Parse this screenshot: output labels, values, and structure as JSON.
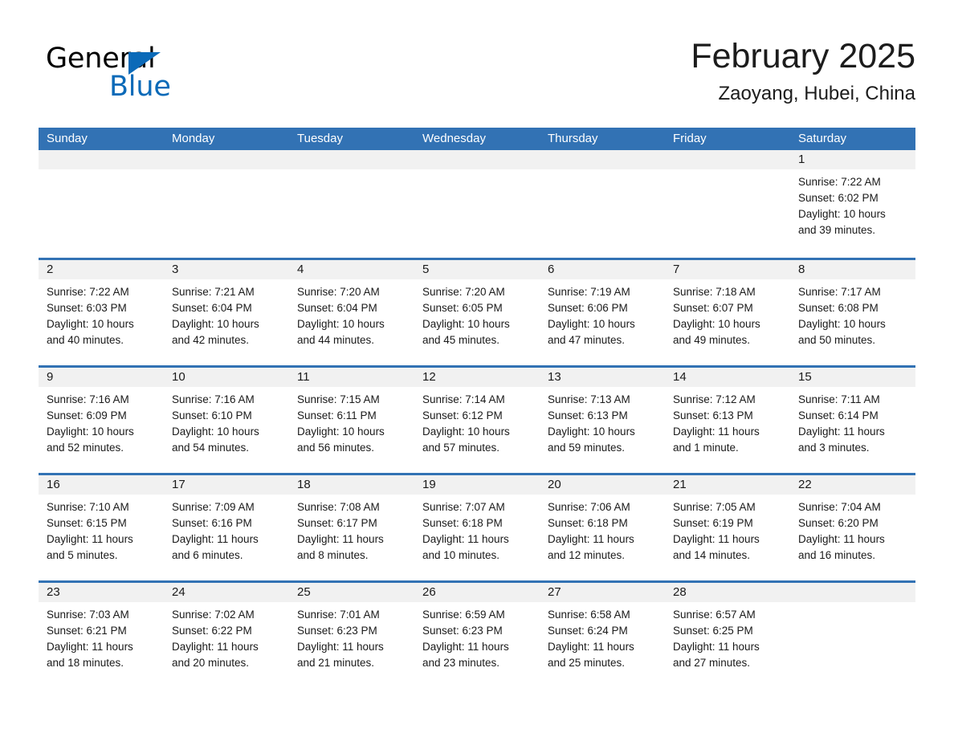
{
  "brand": {
    "name_part1": "General",
    "name_part2": "Blue",
    "accent_color": "#0b6ab8",
    "triangle_icon": "triangle-icon"
  },
  "header": {
    "title": "February 2025",
    "subtitle": "Zaoyang, Hubei, China"
  },
  "theme": {
    "header_blue": "#3272b4",
    "daynum_band": "#f1f1f1",
    "text": "#1a1a1a"
  },
  "calendar": {
    "weekday_headers": [
      "Sunday",
      "Monday",
      "Tuesday",
      "Wednesday",
      "Thursday",
      "Friday",
      "Saturday"
    ],
    "weeks": [
      [
        {
          "day": "",
          "lines": []
        },
        {
          "day": "",
          "lines": []
        },
        {
          "day": "",
          "lines": []
        },
        {
          "day": "",
          "lines": []
        },
        {
          "day": "",
          "lines": []
        },
        {
          "day": "",
          "lines": []
        },
        {
          "day": "1",
          "lines": [
            "Sunrise: 7:22 AM",
            "Sunset: 6:02 PM",
            "Daylight: 10 hours",
            "and 39 minutes."
          ]
        }
      ],
      [
        {
          "day": "2",
          "lines": [
            "Sunrise: 7:22 AM",
            "Sunset: 6:03 PM",
            "Daylight: 10 hours",
            "and 40 minutes."
          ]
        },
        {
          "day": "3",
          "lines": [
            "Sunrise: 7:21 AM",
            "Sunset: 6:04 PM",
            "Daylight: 10 hours",
            "and 42 minutes."
          ]
        },
        {
          "day": "4",
          "lines": [
            "Sunrise: 7:20 AM",
            "Sunset: 6:04 PM",
            "Daylight: 10 hours",
            "and 44 minutes."
          ]
        },
        {
          "day": "5",
          "lines": [
            "Sunrise: 7:20 AM",
            "Sunset: 6:05 PM",
            "Daylight: 10 hours",
            "and 45 minutes."
          ]
        },
        {
          "day": "6",
          "lines": [
            "Sunrise: 7:19 AM",
            "Sunset: 6:06 PM",
            "Daylight: 10 hours",
            "and 47 minutes."
          ]
        },
        {
          "day": "7",
          "lines": [
            "Sunrise: 7:18 AM",
            "Sunset: 6:07 PM",
            "Daylight: 10 hours",
            "and 49 minutes."
          ]
        },
        {
          "day": "8",
          "lines": [
            "Sunrise: 7:17 AM",
            "Sunset: 6:08 PM",
            "Daylight: 10 hours",
            "and 50 minutes."
          ]
        }
      ],
      [
        {
          "day": "9",
          "lines": [
            "Sunrise: 7:16 AM",
            "Sunset: 6:09 PM",
            "Daylight: 10 hours",
            "and 52 minutes."
          ]
        },
        {
          "day": "10",
          "lines": [
            "Sunrise: 7:16 AM",
            "Sunset: 6:10 PM",
            "Daylight: 10 hours",
            "and 54 minutes."
          ]
        },
        {
          "day": "11",
          "lines": [
            "Sunrise: 7:15 AM",
            "Sunset: 6:11 PM",
            "Daylight: 10 hours",
            "and 56 minutes."
          ]
        },
        {
          "day": "12",
          "lines": [
            "Sunrise: 7:14 AM",
            "Sunset: 6:12 PM",
            "Daylight: 10 hours",
            "and 57 minutes."
          ]
        },
        {
          "day": "13",
          "lines": [
            "Sunrise: 7:13 AM",
            "Sunset: 6:13 PM",
            "Daylight: 10 hours",
            "and 59 minutes."
          ]
        },
        {
          "day": "14",
          "lines": [
            "Sunrise: 7:12 AM",
            "Sunset: 6:13 PM",
            "Daylight: 11 hours",
            "and 1 minute."
          ]
        },
        {
          "day": "15",
          "lines": [
            "Sunrise: 7:11 AM",
            "Sunset: 6:14 PM",
            "Daylight: 11 hours",
            "and 3 minutes."
          ]
        }
      ],
      [
        {
          "day": "16",
          "lines": [
            "Sunrise: 7:10 AM",
            "Sunset: 6:15 PM",
            "Daylight: 11 hours",
            "and 5 minutes."
          ]
        },
        {
          "day": "17",
          "lines": [
            "Sunrise: 7:09 AM",
            "Sunset: 6:16 PM",
            "Daylight: 11 hours",
            "and 6 minutes."
          ]
        },
        {
          "day": "18",
          "lines": [
            "Sunrise: 7:08 AM",
            "Sunset: 6:17 PM",
            "Daylight: 11 hours",
            "and 8 minutes."
          ]
        },
        {
          "day": "19",
          "lines": [
            "Sunrise: 7:07 AM",
            "Sunset: 6:18 PM",
            "Daylight: 11 hours",
            "and 10 minutes."
          ]
        },
        {
          "day": "20",
          "lines": [
            "Sunrise: 7:06 AM",
            "Sunset: 6:18 PM",
            "Daylight: 11 hours",
            "and 12 minutes."
          ]
        },
        {
          "day": "21",
          "lines": [
            "Sunrise: 7:05 AM",
            "Sunset: 6:19 PM",
            "Daylight: 11 hours",
            "and 14 minutes."
          ]
        },
        {
          "day": "22",
          "lines": [
            "Sunrise: 7:04 AM",
            "Sunset: 6:20 PM",
            "Daylight: 11 hours",
            "and 16 minutes."
          ]
        }
      ],
      [
        {
          "day": "23",
          "lines": [
            "Sunrise: 7:03 AM",
            "Sunset: 6:21 PM",
            "Daylight: 11 hours",
            "and 18 minutes."
          ]
        },
        {
          "day": "24",
          "lines": [
            "Sunrise: 7:02 AM",
            "Sunset: 6:22 PM",
            "Daylight: 11 hours",
            "and 20 minutes."
          ]
        },
        {
          "day": "25",
          "lines": [
            "Sunrise: 7:01 AM",
            "Sunset: 6:23 PM",
            "Daylight: 11 hours",
            "and 21 minutes."
          ]
        },
        {
          "day": "26",
          "lines": [
            "Sunrise: 6:59 AM",
            "Sunset: 6:23 PM",
            "Daylight: 11 hours",
            "and 23 minutes."
          ]
        },
        {
          "day": "27",
          "lines": [
            "Sunrise: 6:58 AM",
            "Sunset: 6:24 PM",
            "Daylight: 11 hours",
            "and 25 minutes."
          ]
        },
        {
          "day": "28",
          "lines": [
            "Sunrise: 6:57 AM",
            "Sunset: 6:25 PM",
            "Daylight: 11 hours",
            "and 27 minutes."
          ]
        },
        {
          "day": "",
          "lines": []
        }
      ]
    ]
  }
}
